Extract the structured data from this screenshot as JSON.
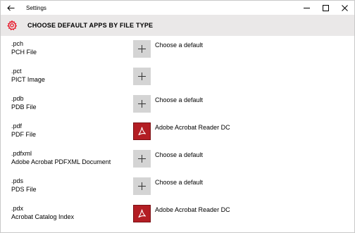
{
  "window": {
    "title": "Settings"
  },
  "header": {
    "title": "CHOOSE DEFAULT APPS BY FILE TYPE"
  },
  "colors": {
    "header_bg": "#eae8e8",
    "gear_accent": "#e81123",
    "plus_tile": "#d4d4d4",
    "acrobat_tile": "#b31e24"
  },
  "rows": [
    {
      "ext": ".pch",
      "desc": "PCH File",
      "app": "Choose a default",
      "icon": "plus-icon"
    },
    {
      "ext": ".pct",
      "desc": "PICT Image",
      "app": "",
      "icon": "plus-icon"
    },
    {
      "ext": ".pdb",
      "desc": "PDB File",
      "app": "Choose a default",
      "icon": "plus-icon"
    },
    {
      "ext": ".pdf",
      "desc": "PDF File",
      "app": "Adobe Acrobat Reader DC",
      "icon": "acrobat-icon"
    },
    {
      "ext": ".pdfxml",
      "desc": "Adobe Acrobat PDFXML Document",
      "app": "Choose a default",
      "icon": "plus-icon"
    },
    {
      "ext": ".pds",
      "desc": "PDS File",
      "app": "Choose a default",
      "icon": "plus-icon"
    },
    {
      "ext": ".pdx",
      "desc": "Acrobat Catalog Index",
      "app": "Adobe Acrobat Reader DC",
      "icon": "acrobat-icon"
    }
  ]
}
